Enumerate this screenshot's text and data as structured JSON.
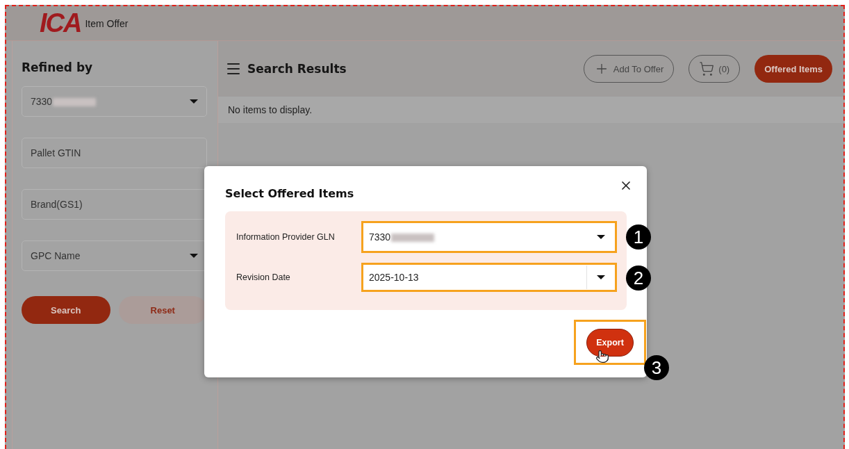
{
  "header": {
    "logo": "ICA",
    "title": "Item Offer"
  },
  "sidebar": {
    "title": "Refined by",
    "filters": [
      {
        "kind": "select",
        "value": "7330",
        "redacted": true
      },
      {
        "kind": "input",
        "placeholder": "Pallet GTIN"
      },
      {
        "kind": "input",
        "placeholder": "Brand(GS1)"
      },
      {
        "kind": "select",
        "placeholder": "GPC Name"
      }
    ],
    "buttons": [
      {
        "kind": "primary",
        "label": "Search"
      },
      {
        "kind": "secondary",
        "label": "Reset"
      }
    ]
  },
  "results": {
    "title": "Search Results",
    "actions": [
      {
        "kind": "add",
        "label": "Add To Offer"
      },
      {
        "kind": "cart",
        "label": "(0)"
      },
      {
        "kind": "primary",
        "label": "Offered Items"
      }
    ],
    "empty_message": "No items to display."
  },
  "dialog": {
    "title": "Select Offered Items",
    "fields": [
      {
        "kind": "select",
        "label": "Information Provider GLN",
        "value": "7330",
        "redacted": true,
        "step": "1"
      },
      {
        "kind": "date",
        "label": "Revision Date",
        "value": "2025-10-13",
        "redacted": false,
        "step": "2"
      }
    ],
    "export": {
      "label": "Export",
      "step": "3"
    }
  }
}
